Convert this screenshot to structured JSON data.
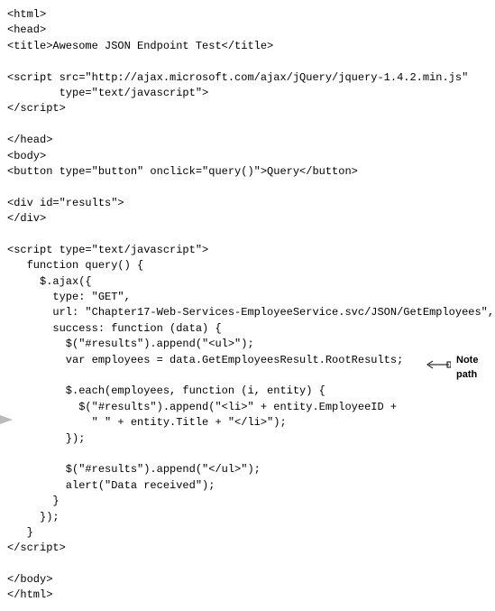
{
  "code": {
    "l01": "<html>",
    "l02": "<head>",
    "l03": "<title>Awesome JSON Endpoint Test</title>",
    "l04": "",
    "l05": "<script src=\"http://ajax.microsoft.com/ajax/jQuery/jquery-1.4.2.min.js\"",
    "l06": "        type=\"text/javascript\">",
    "l07": "</script>",
    "l08": "",
    "l09": "</head>",
    "l10": "<body>",
    "l11": "<button type=\"button\" onclick=\"query()\">Query</button>",
    "l12": "",
    "l13": "<div id=\"results\">",
    "l14": "</div>",
    "l15": "",
    "l16": "<script type=\"text/javascript\">",
    "l17": "   function query() {",
    "l18": "     $.ajax({",
    "l19": "       type: \"GET\",",
    "l20": "       url: \"Chapter17-Web-Services-EmployeeService.svc/JSON/GetEmployees\",",
    "l21": "       success: function (data) {",
    "l22": "         $(\"#results\").append(\"<ul>\");",
    "l23": "         var employees = data.GetEmployeesResult.RootResults;",
    "l24": "",
    "l25": "         $.each(employees, function (i, entity) {",
    "l26": "           $(\"#results\").append(\"<li>\" + entity.EmployeeID +",
    "l27": "             \" \" + entity.Title + \"</li>\");",
    "l28": "         });",
    "l29": "",
    "l30": "         $(\"#results\").append(\"</ul>\");",
    "l31": "         alert(\"Data received\");",
    "l32": "       }",
    "l33": "     });",
    "l34": "   }",
    "l35": "</script>",
    "l36": "",
    "l37": "</body>",
    "l38": "</html>"
  },
  "annotation": {
    "note_line1": "Note",
    "note_line2": "path",
    "arrow": "⟵"
  }
}
